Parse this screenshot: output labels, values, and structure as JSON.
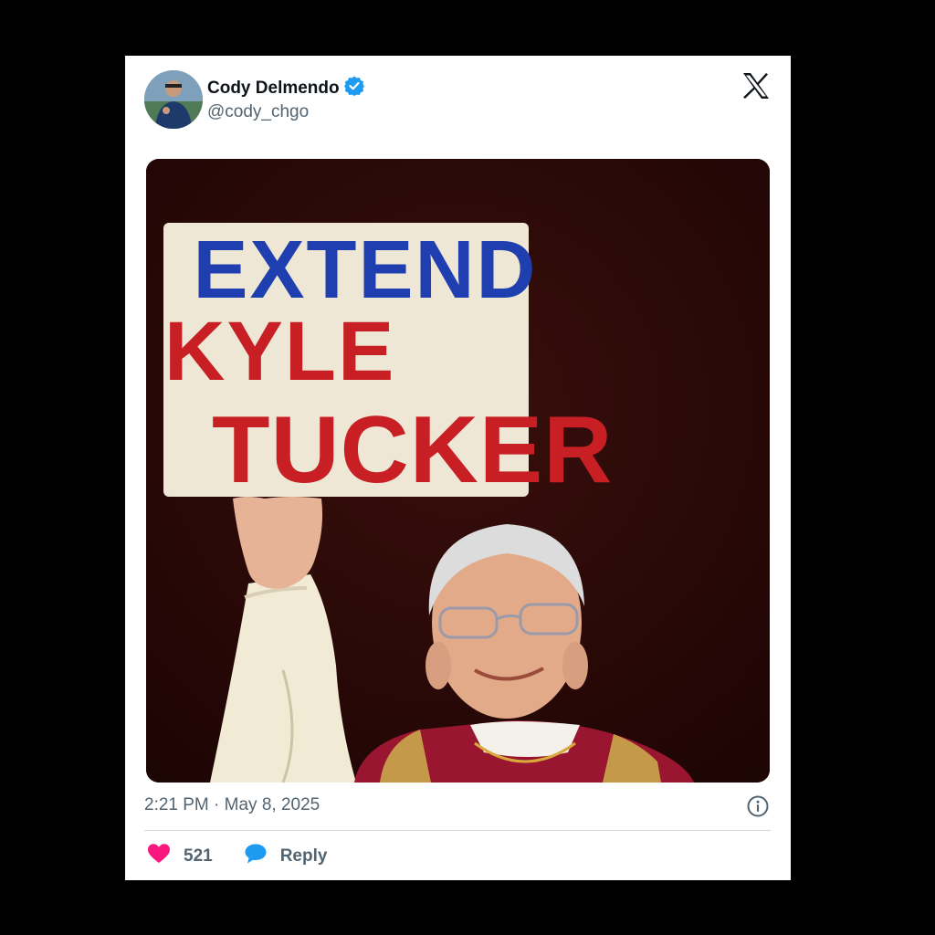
{
  "author": {
    "name": "Cody Delmendo",
    "handle": "@cody_chgo",
    "verified": true
  },
  "media": {
    "sign_lines": [
      "EXTEND",
      "KYLE",
      "TUCKER"
    ],
    "colors": {
      "line1": "#1f3fb0",
      "lines2_3": "#c81f24"
    }
  },
  "tweet": {
    "timestamp": "2:21 PM · May 8, 2025"
  },
  "actions": {
    "likes": "521",
    "reply_label": "Reply"
  },
  "icons": {
    "verified": "verified-badge-icon",
    "platform": "x-logo-icon",
    "info": "info-icon",
    "like": "heart-icon",
    "reply": "speech-bubble-icon"
  },
  "colors": {
    "accent": "#1d9bf0",
    "like": "#f91880",
    "text": "#0f1419",
    "muted": "#536471"
  }
}
